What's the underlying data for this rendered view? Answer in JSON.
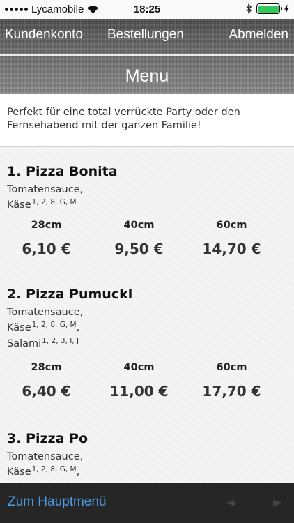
{
  "status": {
    "carrier": "Lycamobile",
    "time": "18:25",
    "battery_level": 1.0,
    "battery_color": "#34c759"
  },
  "nav": {
    "account": "Kundenkonto",
    "orders": "Bestellungen",
    "logout": "Abmelden"
  },
  "header": {
    "title": "Menu"
  },
  "intro": "Perfekt für eine total verrückte Party oder den Fernsehabend mit der ganzen Familie!",
  "sizes": [
    "28cm",
    "40cm",
    "60cm"
  ],
  "items": [
    {
      "name": "1. Pizza Bonita",
      "ingredients": [
        {
          "text": "Tomatensauce,",
          "sup": ""
        },
        {
          "text": "Käse",
          "sup": "1, 2, 8, G, M"
        }
      ],
      "prices": [
        "6,10 €",
        "9,50 €",
        "14,70 €"
      ]
    },
    {
      "name": "2. Pizza Pumuckl",
      "ingredients": [
        {
          "text": "Tomatensauce,",
          "sup": ""
        },
        {
          "text": "Käse",
          "sup": "1, 2, 8, G, M",
          "suffix": ","
        },
        {
          "text": "Salami",
          "sup": "1, 2, 3, I, J"
        }
      ],
      "prices": [
        "6,40 €",
        "11,00 €",
        "17,70 €"
      ]
    },
    {
      "name": "3. Pizza Po",
      "ingredients": [
        {
          "text": "Tomatensauce,",
          "sup": ""
        },
        {
          "text": "Käse",
          "sup": "1, 2, 8, G, M",
          "suffix": ","
        }
      ],
      "prices": []
    }
  ],
  "bottom": {
    "back_label": "Zum Hauptmenü",
    "prev_icon": "◄",
    "next_icon": "►"
  }
}
